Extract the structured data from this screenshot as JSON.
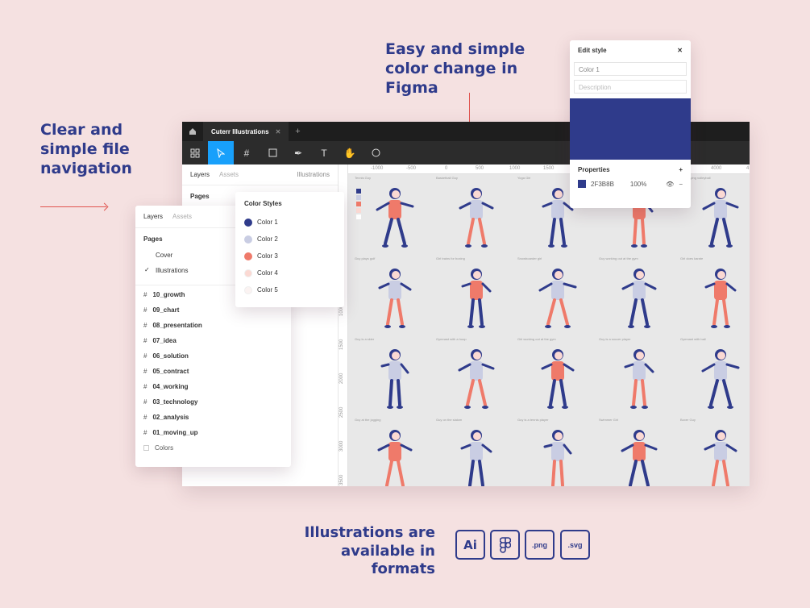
{
  "headlines": {
    "left": "Clear and simple file navigation",
    "top": "Easy and simple color change in Figma",
    "bottom": "Illustrations are available in formats"
  },
  "window": {
    "tab_title": "Cuterr Illustrations",
    "left_tabs": [
      "Layers",
      "Assets"
    ],
    "page_selector": "Illustrations",
    "pages_header": "Pages",
    "ruler_x": [
      "-1000",
      "-500",
      "0",
      "500",
      "1000",
      "1500",
      "4000",
      "4"
    ],
    "ruler_y": [
      "1000",
      "1500",
      "2000",
      "2500",
      "3000",
      "3500"
    ]
  },
  "figures": [
    {
      "cap": "Tennis Guy"
    },
    {
      "cap": "Basketball Guy"
    },
    {
      "cap": "Yoga Girl"
    },
    {
      "cap": "Guy running the race"
    },
    {
      "cap": "Girl playing volleyball"
    },
    {
      "cap": "Guy plays golf"
    },
    {
      "cap": "Girl trains for boxing"
    },
    {
      "cap": "Snowboarder girl"
    },
    {
      "cap": "Guy working out at the gym"
    },
    {
      "cap": "Girl does karate"
    },
    {
      "cap": "Guy is a skier"
    },
    {
      "cap": "Gymnast with a hoop"
    },
    {
      "cap": "Girl working out at the gym"
    },
    {
      "cap": "Guy is a soccer player"
    },
    {
      "cap": "Gymnast with ball"
    },
    {
      "cap": "Guy at the jogging"
    },
    {
      "cap": "Guy on the slalom"
    },
    {
      "cap": "Guy is a tennis player"
    },
    {
      "cap": "Swimmer Girl"
    },
    {
      "cap": "Boxer Guy"
    }
  ],
  "layers_panel": {
    "tabs": [
      "Layers",
      "Assets"
    ],
    "pages_header": "Pages",
    "pages": [
      {
        "label": "Cover",
        "checked": false
      },
      {
        "label": "Illustrations",
        "checked": true
      }
    ],
    "frames": [
      "10_growth",
      "09_chart",
      "08_presentation",
      "07_idea",
      "06_solution",
      "05_contract",
      "04_working",
      "03_technology",
      "02_analysis",
      "01_moving_up"
    ],
    "colors_label": "Colors"
  },
  "color_styles": {
    "title": "Color Styles",
    "items": [
      {
        "label": "Color 1",
        "color": "#2f3b8b"
      },
      {
        "label": "Color 2",
        "color": "#c9cde3"
      },
      {
        "label": "Color 3",
        "color": "#ef7a6a"
      },
      {
        "label": "Color 4",
        "color": "#fbd9d3"
      },
      {
        "label": "Color 5",
        "color": "#fbf3f2"
      }
    ]
  },
  "edit_style": {
    "title": "Edit style",
    "name_value": "Color 1",
    "description_placeholder": "Description",
    "preview_color": "#2f3b8b",
    "properties_label": "Properties",
    "hex": "2F3B8B",
    "opacity": "100%"
  },
  "formats": {
    "ai": "Ai",
    "png": ".png",
    "svg": ".svg"
  },
  "colors": {
    "navy": "#2f3b8b",
    "coral": "#ef7a6a",
    "pink_bg": "#f5e1e1",
    "figma_blue": "#18a0fb"
  }
}
